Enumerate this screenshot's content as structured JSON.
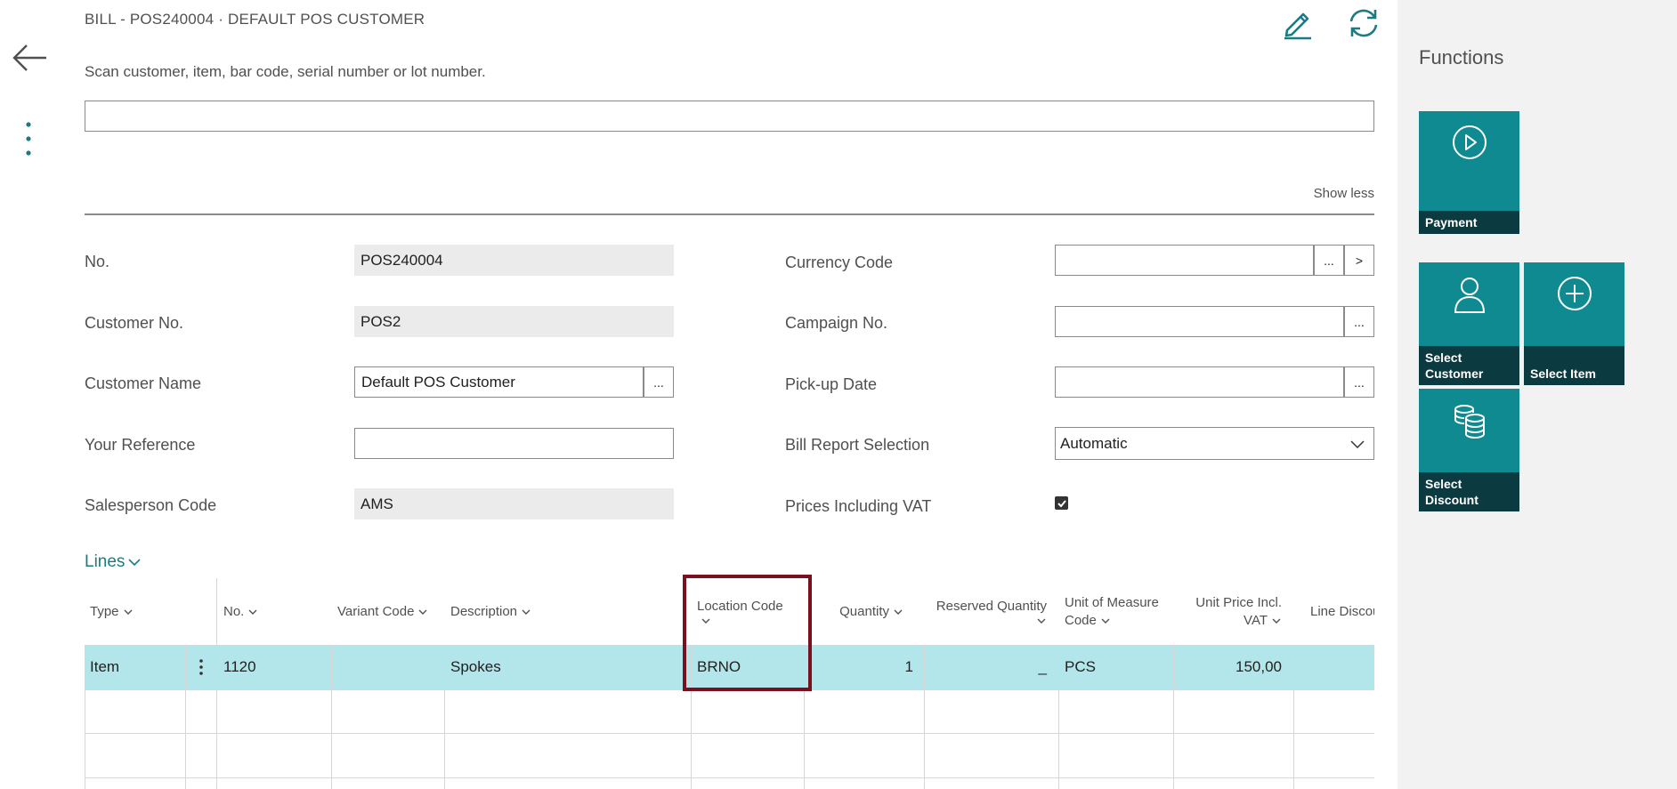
{
  "header": {
    "title": "BILL - POS240004 · DEFAULT POS CUSTOMER",
    "icons": [
      "back-arrow-icon",
      "more-vertical-icon",
      "edit-pencil-icon",
      "refresh-icon"
    ]
  },
  "scan": {
    "label": "Scan customer, item, bar code, serial number or lot number.",
    "value": ""
  },
  "show_less": "Show less",
  "fields_left": [
    {
      "label": "No.",
      "value": "POS240004"
    },
    {
      "label": "Customer No.",
      "value": "POS2"
    },
    {
      "label": "Customer Name",
      "value": "Default POS Customer"
    },
    {
      "label": "Your Reference",
      "value": ""
    },
    {
      "label": "Salesperson Code",
      "value": "AMS"
    }
  ],
  "fields_right": [
    {
      "label": "Currency Code",
      "value": ""
    },
    {
      "label": "Campaign No.",
      "value": ""
    },
    {
      "label": "Pick-up Date",
      "value": ""
    },
    {
      "label": "Bill Report Selection",
      "value": "Automatic"
    },
    {
      "label": "Prices Including VAT",
      "checked": true
    }
  ],
  "assist_labels": {
    "lookup": "...",
    "drill": ">"
  },
  "lines": {
    "title": "Lines",
    "columns": [
      {
        "l1": "Type",
        "l2": ""
      },
      {
        "l1": "No.",
        "l2": ""
      },
      {
        "l1": "Variant Code",
        "l2": ""
      },
      {
        "l1": "Description",
        "l2": ""
      },
      {
        "l1": "Location Code",
        "l2": ""
      },
      {
        "l1": "Quantity",
        "l2": ""
      },
      {
        "l1": "Reserved Quantity",
        "l2": ""
      },
      {
        "l1": "Unit of Measure",
        "l2": "Code"
      },
      {
        "l1": "Unit Price Incl.",
        "l2": "VAT"
      },
      {
        "l1": "Line Discou",
        "l2": ""
      }
    ],
    "rows": [
      {
        "type": "Item",
        "no": "1120",
        "variant": "",
        "description": "Spokes",
        "location": "BRNO",
        "quantity": "1",
        "reserved": "_",
        "uom": "PCS",
        "unit_price": "150,00",
        "line_discount": ""
      }
    ]
  },
  "functions": {
    "title": "Functions",
    "tiles": [
      {
        "label": "Payment",
        "icon": "play-circle-icon"
      },
      {
        "label": "Select Customer",
        "icon": "person-icon"
      },
      {
        "label": "Select Item",
        "icon": "plus-circle-icon"
      },
      {
        "label": "Select Discount",
        "icon": "coins-icon"
      }
    ]
  },
  "colors": {
    "accent": "#0f8a91",
    "tile_label_bg": "#0b3b40",
    "row_selected": "#b2e6eb",
    "highlight": "#7a0f1e",
    "link": "#1c7a82"
  }
}
